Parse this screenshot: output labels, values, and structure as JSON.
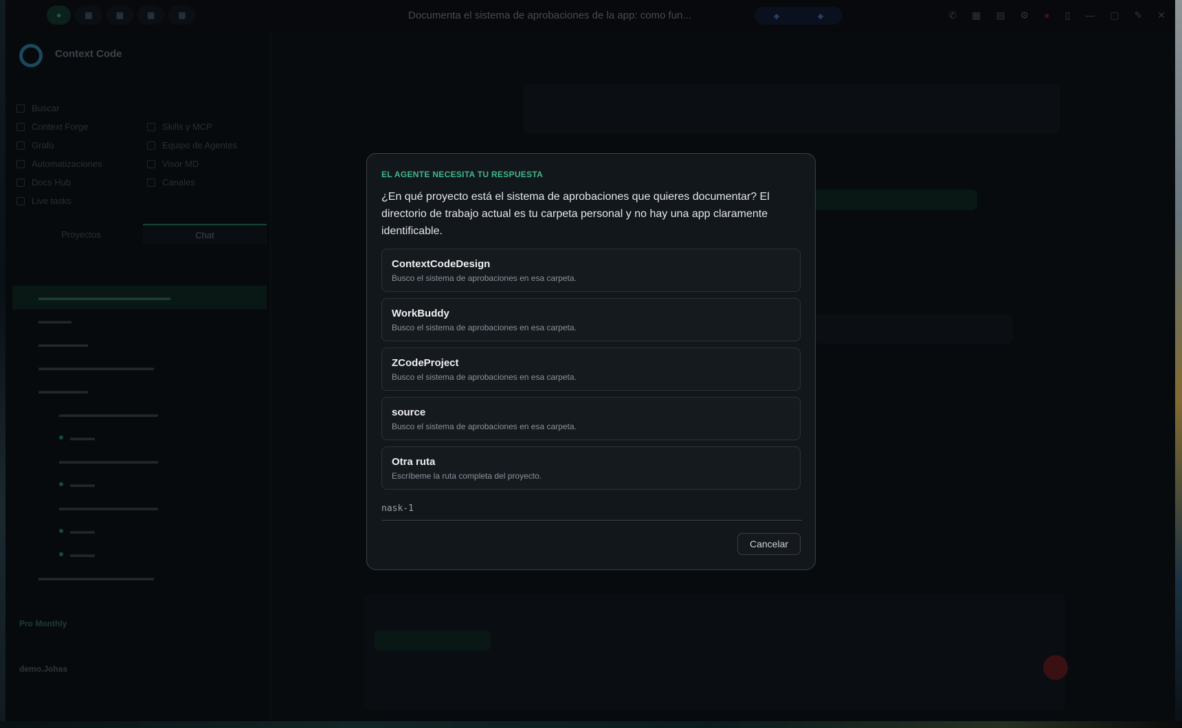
{
  "dialog": {
    "label": "EL AGENTE NECESITA TU RESPUESTA",
    "question": "¿En qué proyecto está el sistema de aprobaciones que quieres documentar? El directorio de trabajo actual es tu carpeta personal y no hay una app claramente identificable.",
    "options": [
      {
        "title": "ContextCodeDesign",
        "description": "Busco el sistema de aprobaciones en esa carpeta."
      },
      {
        "title": "WorkBuddy",
        "description": "Busco el sistema de aprobaciones en esa carpeta."
      },
      {
        "title": "ZCodeProject",
        "description": "Busco el sistema de aprobaciones en esa carpeta."
      },
      {
        "title": "source",
        "description": "Busco el sistema de aprobaciones en esa carpeta."
      },
      {
        "title": "Otra ruta",
        "description": "Escríbeme la ruta completa del proyecto."
      }
    ],
    "input_value": "nask-1",
    "cancel_label": "Cancelar"
  },
  "app": {
    "title": "Documenta el sistema de aprobaciones de la app: como fun...",
    "brand": "Context Code",
    "sidebar_items": [
      "Buscar",
      "Context Forge",
      "Grafo",
      "Automatizaciones",
      "Docs Hub",
      "Live tasks",
      "Skills y MCP",
      "Equipo de Agentes",
      "Visor MD",
      "Canales"
    ],
    "tab_projects": "Proyectos",
    "tab_chat": "Chat",
    "plan": "Pro Monthly",
    "user": "demo.Johas"
  },
  "colors": {
    "accent": "#3fb98a",
    "dialog_bg": "#12171c",
    "option_bg": "#151a1f"
  }
}
